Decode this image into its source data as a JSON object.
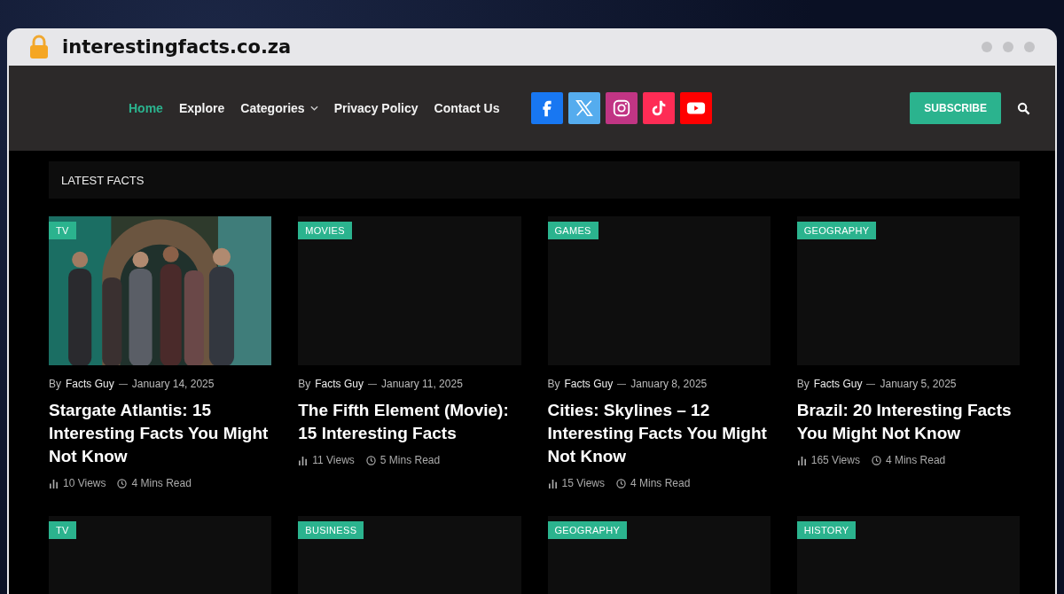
{
  "browser": {
    "url": "interestingfacts.co.za"
  },
  "nav": [
    {
      "label": "Home",
      "selected": true,
      "dropdown": false
    },
    {
      "label": "Explore",
      "selected": false,
      "dropdown": false
    },
    {
      "label": "Categories",
      "selected": false,
      "dropdown": true
    },
    {
      "label": "Privacy Policy",
      "selected": false,
      "dropdown": false
    },
    {
      "label": "Contact Us",
      "selected": false,
      "dropdown": false
    }
  ],
  "social": [
    {
      "kind": "facebook",
      "color": "#1877f2"
    },
    {
      "kind": "x",
      "color": "#55acee"
    },
    {
      "kind": "instagram",
      "color": "#c13584"
    },
    {
      "kind": "tiktok",
      "color": "#fe2c55"
    },
    {
      "kind": "youtube",
      "color": "#ff0000"
    }
  ],
  "subscribe_button": "SUBSCRIBE",
  "section_title": "LATEST FACTS",
  "posts": [
    {
      "kind": "picture",
      "tag": "TV",
      "by": "By",
      "author": "Facts Guy",
      "date": "January 14, 2025",
      "title": "Stargate Atlantis: 15 Interesting Facts You Might Not Know",
      "views": "10 Views",
      "read": "4 Mins Read"
    },
    {
      "kind": "blank",
      "tag": "MOVIES",
      "by": "By",
      "author": "Facts Guy",
      "date": "January 11, 2025",
      "title": "The Fifth Element (Movie): 15 Interesting Facts",
      "views": "11 Views",
      "read": "5 Mins Read"
    },
    {
      "kind": "blank",
      "tag": "GAMES",
      "by": "By",
      "author": "Facts Guy",
      "date": "January 8, 2025",
      "title": "Cities: Skylines – 12 Interesting Facts You Might Not Know",
      "views": "15 Views",
      "read": "4 Mins Read"
    },
    {
      "kind": "blank",
      "tag": "GEOGRAPHY",
      "by": "By",
      "author": "Facts Guy",
      "date": "January 5, 2025",
      "title": "Brazil: 20 Interesting Facts You Might Not Know",
      "views": "165 Views",
      "read": "4 Mins Read"
    },
    {
      "kind": "blank",
      "tag": "TV"
    },
    {
      "kind": "blank",
      "tag": "BUSINESS"
    },
    {
      "kind": "blank",
      "tag": "GEOGRAPHY"
    },
    {
      "kind": "blank",
      "tag": "HISTORY"
    }
  ]
}
